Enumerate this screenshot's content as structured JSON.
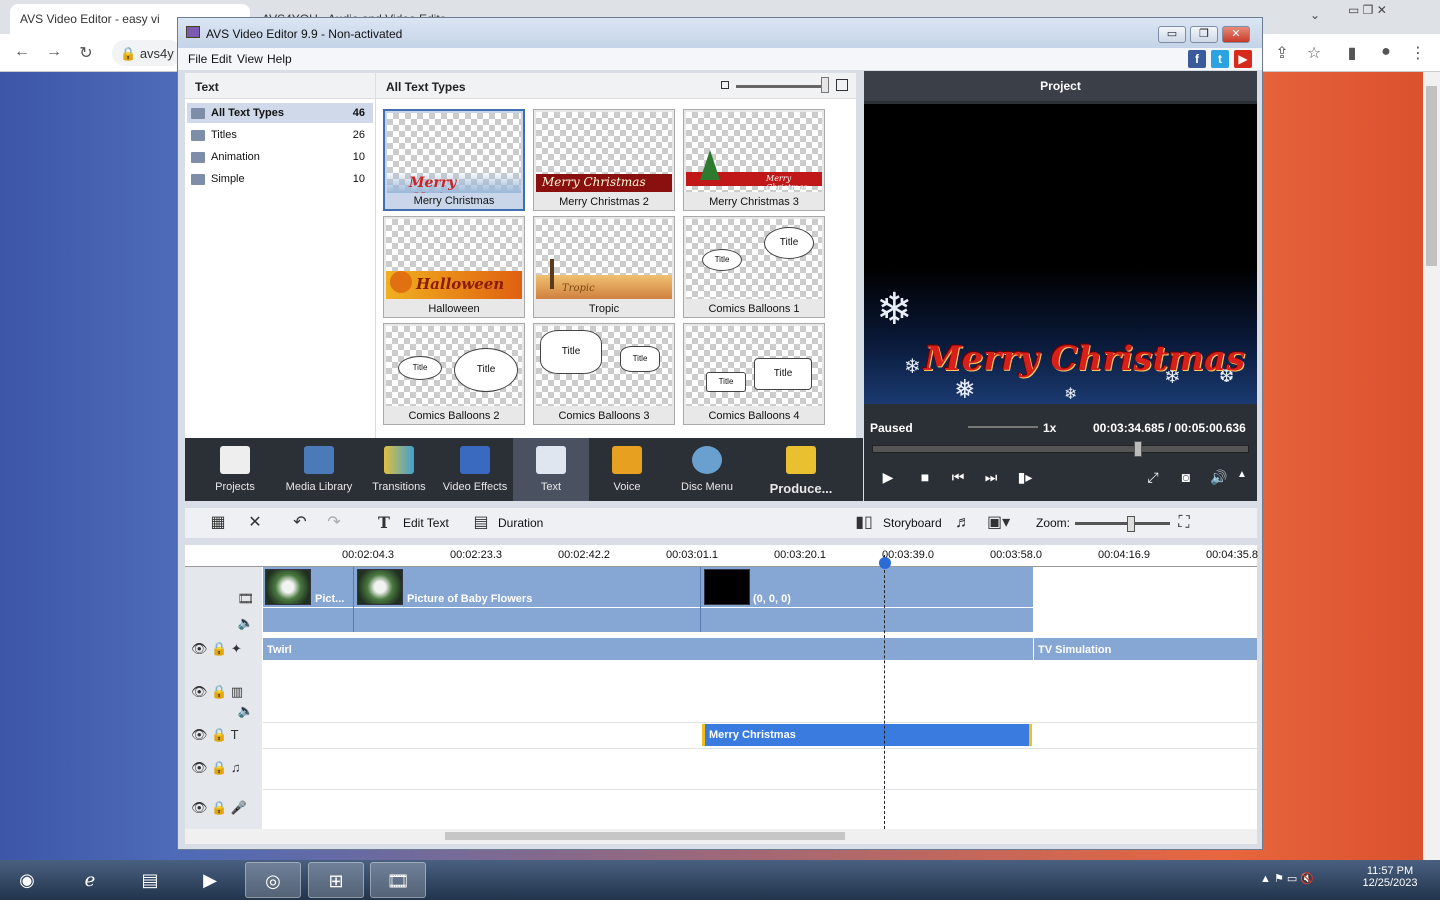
{
  "browser": {
    "tab1_title": "AVS Video Editor - easy vi",
    "tab2_title": "AVS4YOU - Audio and Video Edito",
    "address": "avs4y"
  },
  "window": {
    "title": "AVS Video Editor 9.9 - Non-activated",
    "minimize": "▭",
    "maximize": "❐",
    "close": "✕"
  },
  "menu": [
    "File",
    "Edit",
    "View",
    "Help"
  ],
  "social": [
    "f",
    "t",
    "▶"
  ],
  "text_panel": {
    "header": "Text",
    "categories": [
      {
        "label": "All Text Types",
        "count": "46"
      },
      {
        "label": "Titles",
        "count": "26"
      },
      {
        "label": "Animation",
        "count": "10"
      },
      {
        "label": "Simple",
        "count": "10"
      }
    ]
  },
  "gallery": {
    "header": "All Text Types",
    "items": [
      {
        "label": "Merry Christmas",
        "deco": "Merry Christmas"
      },
      {
        "label": "Merry Christmas 2",
        "deco": "Merry Christmas"
      },
      {
        "label": "Merry Christmas 3",
        "deco": "Merry Christmas"
      },
      {
        "label": "Halloween",
        "deco": "Halloween"
      },
      {
        "label": "Tropic",
        "deco": "Tropic"
      },
      {
        "label": "Comics Balloons 1",
        "deco": "Title",
        "deco2": "Title"
      },
      {
        "label": "Comics Balloons 2",
        "deco": "Title",
        "deco2": "Title"
      },
      {
        "label": "Comics Balloons 3",
        "deco": "Title",
        "deco2": "Title"
      },
      {
        "label": "Comics Balloons 4",
        "deco": "Title",
        "deco2": "Title"
      }
    ]
  },
  "preview": {
    "header": "Project",
    "overlay_text": "Merry Christmas",
    "status": "Paused",
    "speed": "1x",
    "time": "00:03:34.685 / 00:05:00.636"
  },
  "toolbar": [
    "Projects",
    "Media Library",
    "Transitions",
    "Video Effects",
    "Text",
    "Voice",
    "Disc Menu",
    "Produce..."
  ],
  "timeline_tools": {
    "edit_text": "Edit Text",
    "duration": "Duration",
    "storyboard": "Storyboard",
    "zoom": "Zoom:"
  },
  "ruler": [
    "00:02:04.3",
    "00:02:23.3",
    "00:02:42.2",
    "00:03:01.1",
    "00:03:20.1",
    "00:03:39.0",
    "00:03:58.0",
    "00:04:16.9",
    "00:04:35.8"
  ],
  "tracks": {
    "clip1": "Pict...",
    "clip2": "Picture of Baby Flowers",
    "clip3": "(0, 0, 0)",
    "fx1": "Twirl",
    "fx2": "TV Simulation",
    "text_clip": "Merry Christmas"
  },
  "taskbar": {
    "time": "11:57 PM",
    "date": "12/25/2023"
  },
  "colors": {
    "accent": "#3a7be0",
    "track": "#86a6d4",
    "dark_panel": "#2b2f36"
  }
}
